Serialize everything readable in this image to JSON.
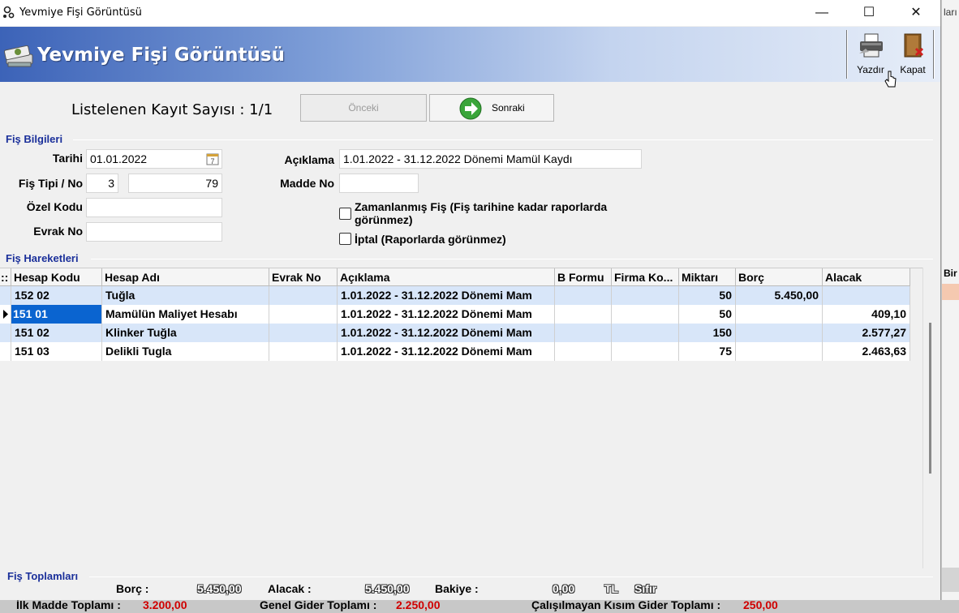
{
  "window": {
    "title": "Yevmiye Fişi Görüntüsü",
    "minimize": "—",
    "maximize": "☐",
    "close": "✕"
  },
  "banner": {
    "title": "Yevmiye Fişi Görüntüsü"
  },
  "toolbar": {
    "print_label": "Yazdır",
    "close_label": "Kapat"
  },
  "nav": {
    "listed_text": "Listelenen Kayıt Sayısı : 1/1",
    "prev_label": "Önceki",
    "next_label": "Sonraki"
  },
  "fis_bilgileri": {
    "group_title": "Fiş Bilgileri",
    "tarih_label": "Tarihi",
    "tarih_value": "01.01.2022",
    "fis_tipi_label": "Fiş Tipi / No",
    "fis_tipi_value": "3",
    "fis_no_value": "79",
    "ozel_kodu_label": "Özel Kodu",
    "ozel_kodu_value": "",
    "evrak_no_label": "Evrak No",
    "evrak_no_value": "",
    "aciklama_label": "Açıklama",
    "aciklama_value": "1.01.2022 - 31.12.2022 Dönemi Mamül Kaydı",
    "madde_no_label": "Madde No",
    "madde_no_value": "",
    "zamanlanmis_label_1": "Zamanlanmış Fiş (Fiş tarihine kadar raporlarda",
    "zamanlanmis_label_2": "görünmez)",
    "zamanlanmis_checked": false,
    "iptal_label": "İptal (Raporlarda görünmez)",
    "iptal_checked": false
  },
  "fis_hareketleri": {
    "group_title": "Fiş Hareketleri",
    "columns": [
      "Hesap Kodu",
      "Hesap Adı",
      "Evrak No",
      "Açıklama",
      "B Formu",
      "Firma Ko...",
      "Miktarı",
      "Borç",
      "Alacak"
    ],
    "rows": [
      {
        "hesap_kodu": "152 02",
        "hesap_adi": "Tuğla",
        "evrak_no": "",
        "aciklama": "1.01.2022 - 31.12.2022 Dönemi Mam",
        "b_formu": "",
        "firma_kodu": "",
        "miktar": "50",
        "borc": "5.450,00",
        "alacak": ""
      },
      {
        "hesap_kodu": "151 01",
        "hesap_adi": "Mamülün Maliyet Hesabı",
        "evrak_no": "",
        "aciklama": "1.01.2022 - 31.12.2022 Dönemi Mam",
        "b_formu": "",
        "firma_kodu": "",
        "miktar": "50",
        "borc": "",
        "alacak": "409,10"
      },
      {
        "hesap_kodu": "151 02",
        "hesap_adi": "Klinker Tuğla",
        "evrak_no": "",
        "aciklama": "1.01.2022 - 31.12.2022 Dönemi Mam",
        "b_formu": "",
        "firma_kodu": "",
        "miktar": "150",
        "borc": "",
        "alacak": "2.577,27"
      },
      {
        "hesap_kodu": "151 03",
        "hesap_adi": "Delikli Tugla",
        "evrak_no": "",
        "aciklama": "1.01.2022 - 31.12.2022 Dönemi Mam",
        "b_formu": "",
        "firma_kodu": "",
        "miktar": "75",
        "borc": "",
        "alacak": "2.463,63"
      }
    ]
  },
  "fis_toplamlari": {
    "group_title": "Fiş Toplamları",
    "borc_label": "Borç :",
    "borc_value": "5.450,00",
    "alacak_label": "Alacak :",
    "alacak_value": "5.450,00",
    "bakiye_label": "Bakiye :",
    "bakiye_value": "0,00",
    "currency": "TL",
    "bakiye_text": "Sıfır"
  },
  "background": {
    "tab_text": "ları",
    "bir_text": "Bir",
    "bottom_1_label": "İlk Madde Toplamı :",
    "bottom_1_value": "3.200,00",
    "bottom_2_label": "Genel Gider Toplamı :",
    "bottom_2_value": "2.250,00",
    "bottom_3_label": "Çalışılmayan Kısım Gider Toplamı :",
    "bottom_3_value": "250,00"
  },
  "colors": {
    "banner_start": "#3c63b8",
    "group_title": "#1a2f9a",
    "selection": "#0a64d0",
    "alt_row": "#d8e6f9"
  }
}
